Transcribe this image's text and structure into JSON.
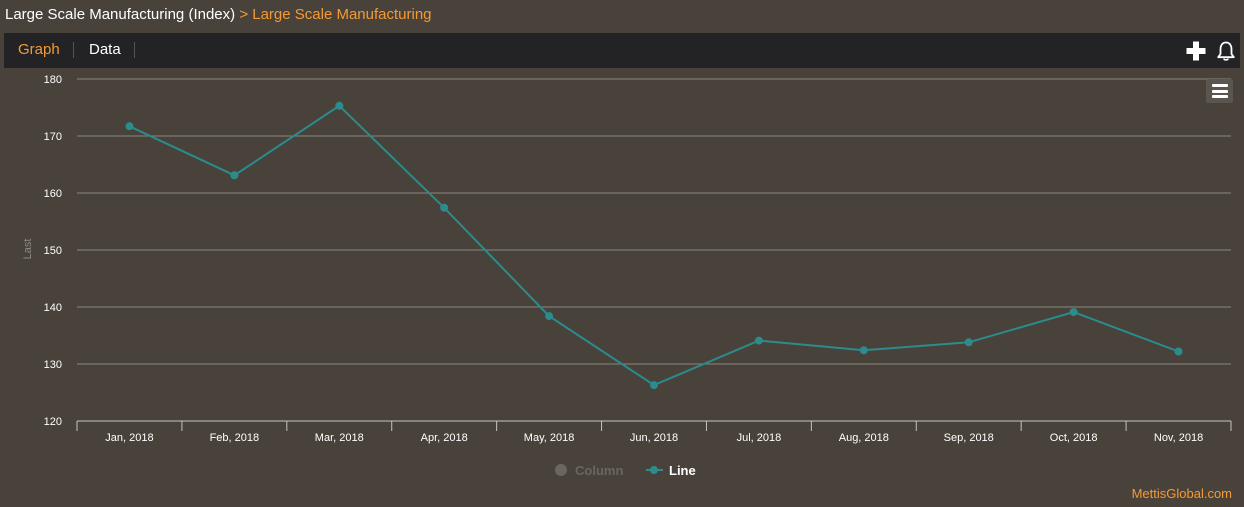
{
  "breadcrumb": {
    "parent": "Large Scale Manufacturing (Index)",
    "separator": ">",
    "current": "Large Scale Manufacturing"
  },
  "tabs": {
    "graph": "Graph",
    "data": "Data"
  },
  "icons": {
    "add": "plus-icon",
    "alert": "bell-icon",
    "menu": "hamburger-menu-icon"
  },
  "legend": {
    "column": "Column",
    "line": "Line"
  },
  "credit": "MettisGlobal.com",
  "colors": {
    "accent": "#f59a33",
    "series": "#2a8c8c",
    "background": "#48423b",
    "grid": "#8a857f"
  },
  "chart_data": {
    "type": "line",
    "categories": [
      "Jan, 2018",
      "Feb, 2018",
      "Mar, 2018",
      "Apr, 2018",
      "May, 2018",
      "Jun, 2018",
      "Jul, 2018",
      "Aug, 2018",
      "Sep, 2018",
      "Oct, 2018",
      "Nov, 2018"
    ],
    "series": [
      {
        "name": "Line",
        "values": [
          171.7,
          163.1,
          175.3,
          157.4,
          138.4,
          126.3,
          134.1,
          132.4,
          133.8,
          139.1,
          132.2
        ]
      }
    ],
    "ylabel": "Last",
    "xlabel": "",
    "ylim": [
      120,
      180
    ],
    "yticks": [
      120,
      130,
      140,
      150,
      160,
      170,
      180
    ],
    "grid": true,
    "legend_position": "bottom"
  }
}
